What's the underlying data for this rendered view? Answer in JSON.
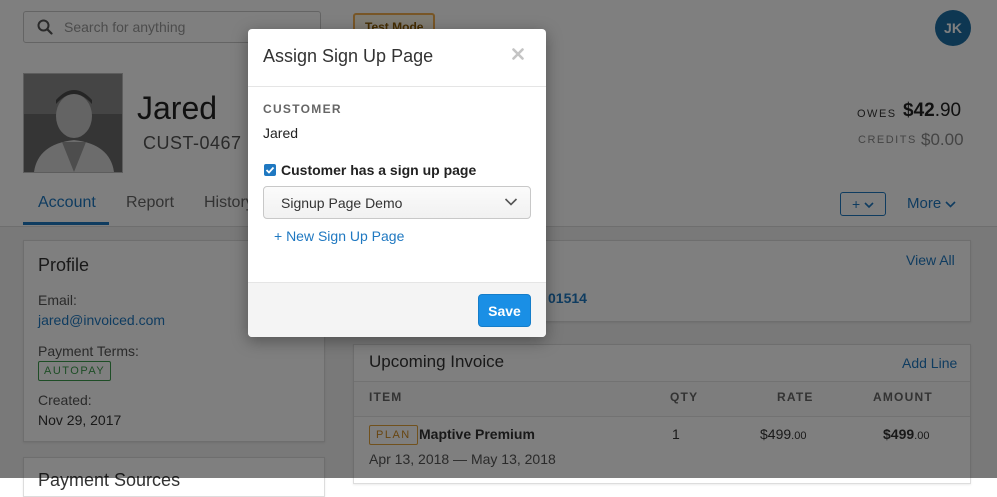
{
  "topbar": {
    "search_placeholder": "Search for anything",
    "test_mode_label": "Test Mode",
    "user_initials": "JK"
  },
  "customer": {
    "name": "Jared",
    "number": "CUST-0467",
    "owes_label": "OWES",
    "owes_dollars": "$42",
    "owes_cents": ".90",
    "credits_label": "CREDITS",
    "credits_value": "$0.00"
  },
  "tabs": [
    {
      "label": "Account",
      "active": true
    },
    {
      "label": "Report",
      "active": false
    },
    {
      "label": "History",
      "active": false
    }
  ],
  "actions": {
    "plus_label": "+",
    "more_label": "More"
  },
  "profile": {
    "title": "Profile",
    "email_label": "Email:",
    "email_value": "jared@invoiced.com",
    "payment_terms_label": "Payment Terms:",
    "payment_terms_value": "AUTOPAY",
    "created_label": "Created:",
    "created_value": "Nov 29, 2017",
    "next_card_title": "Payment Sources"
  },
  "invoices_card": {
    "view_all_label": "View All",
    "partial_invoice_number": "01514"
  },
  "upcoming_invoice": {
    "title": "Upcoming Invoice",
    "add_line_label": "Add Line",
    "columns": [
      "ITEM",
      "QTY",
      "RATE",
      "AMOUNT"
    ],
    "rows": [
      {
        "badge": "PLAN",
        "item": "Maptive Premium",
        "period": "Apr 13, 2018 — May 13, 2018",
        "qty": "1",
        "rate_dollars": "$499",
        "rate_cents": ".00",
        "amount_dollars": "$499",
        "amount_cents": ".00"
      }
    ]
  },
  "modal": {
    "title": "Assign Sign Up Page",
    "customer_label": "CUSTOMER",
    "customer_value": "Jared",
    "checkbox_label": "Customer has a sign up page",
    "checkbox_checked": true,
    "select_value": "Signup Page Demo",
    "new_page_link": "+ New Sign Up Page",
    "save_label": "Save"
  },
  "colors": {
    "accent": "#1f78c1",
    "primary_button": "#1a8fe5",
    "test_mode_border": "#f0ad4e",
    "autopay_green": "#3c9b4d",
    "plan_orange": "#d08a20",
    "overlay": "rgba(0,0,0,0.5)"
  },
  "icons": {
    "search": "search-icon",
    "close": "close-icon",
    "chevron": "chevron-down-icon",
    "check": "check-icon"
  }
}
